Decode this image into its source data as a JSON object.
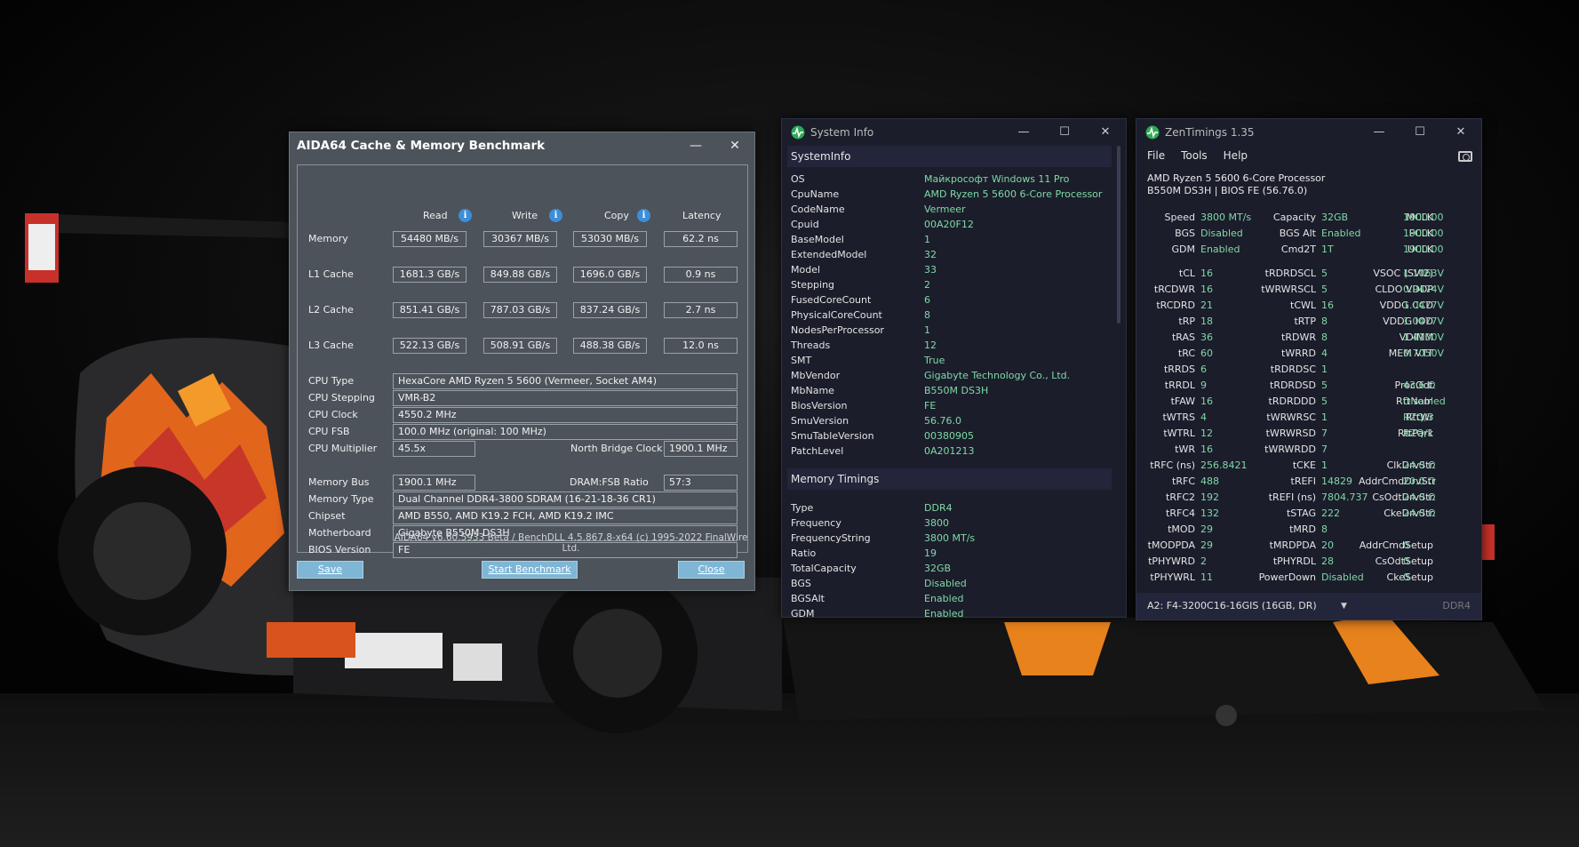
{
  "aida": {
    "title": "AIDA64 Cache & Memory Benchmark",
    "controls": {
      "minimize": "—",
      "close": "✕"
    },
    "columns": [
      "Read",
      "Write",
      "Copy",
      "Latency"
    ],
    "bench": [
      {
        "label": "Memory",
        "read": "54480 MB/s",
        "write": "30367 MB/s",
        "copy": "53030 MB/s",
        "latency": "62.2 ns"
      },
      {
        "label": "L1 Cache",
        "read": "1681.3 GB/s",
        "write": "849.88 GB/s",
        "copy": "1696.0 GB/s",
        "latency": "0.9 ns"
      },
      {
        "label": "L2 Cache",
        "read": "851.41 GB/s",
        "write": "787.03 GB/s",
        "copy": "837.24 GB/s",
        "latency": "2.7 ns"
      },
      {
        "label": "L3 Cache",
        "read": "522.13 GB/s",
        "write": "508.91 GB/s",
        "copy": "488.38 GB/s",
        "latency": "12.0 ns"
      }
    ],
    "cpu_type_label": "CPU Type",
    "cpu_type": "HexaCore AMD Ryzen 5 5600  (Vermeer, Socket AM4)",
    "cpu_stepping_label": "CPU Stepping",
    "cpu_stepping": "VMR-B2",
    "cpu_clock_label": "CPU Clock",
    "cpu_clock": "4550.2 MHz",
    "cpu_fsb_label": "CPU FSB",
    "cpu_fsb": "100.0 MHz  (original: 100 MHz)",
    "cpu_mult_label": "CPU Multiplier",
    "cpu_mult": "45.5x",
    "nb_clock_label": "North Bridge Clock",
    "nb_clock": "1900.1 MHz",
    "mem_bus_label": "Memory Bus",
    "mem_bus": "1900.1 MHz",
    "dram_ratio_label": "DRAM:FSB Ratio",
    "dram_ratio": "57:3",
    "mem_type_label": "Memory Type",
    "mem_type": "Dual Channel DDR4-3800 SDRAM  (16-21-18-36 CR1)",
    "chipset_label": "Chipset",
    "chipset": "AMD B550, AMD K19.2 FCH, AMD K19.2 IMC",
    "mobo_label": "Motherboard",
    "mobo": "Gigabyte B550M DS3H",
    "bios_label": "BIOS Version",
    "bios": "FE",
    "footer": "AIDA64 v6.60.5933 Beta / BenchDLL 4.5.867.8-x64  (c) 1995-2022 FinalWire Ltd.",
    "save": "Save",
    "start": "Start Benchmark",
    "close": "Close"
  },
  "sys": {
    "title": "System Info",
    "controls": {
      "minimize": "—",
      "maximize": "☐",
      "close": "✕"
    },
    "sec1": "SystemInfo",
    "info": [
      {
        "k": "OS",
        "v": "Майкрософт Windows 11 Pro"
      },
      {
        "k": "CpuName",
        "v": "AMD Ryzen 5 5600 6-Core Processor"
      },
      {
        "k": "CodeName",
        "v": "Vermeer"
      },
      {
        "k": "Cpuid",
        "v": "00A20F12"
      },
      {
        "k": "BaseModel",
        "v": "1"
      },
      {
        "k": "ExtendedModel",
        "v": "32"
      },
      {
        "k": "Model",
        "v": "33"
      },
      {
        "k": "Stepping",
        "v": "2"
      },
      {
        "k": "FusedCoreCount",
        "v": "6"
      },
      {
        "k": "PhysicalCoreCount",
        "v": "8"
      },
      {
        "k": "NodesPerProcessor",
        "v": "1"
      },
      {
        "k": "Threads",
        "v": "12"
      },
      {
        "k": "SMT",
        "v": "True"
      },
      {
        "k": "MbVendor",
        "v": "Gigabyte Technology Co., Ltd."
      },
      {
        "k": "MbName",
        "v": "B550M DS3H"
      },
      {
        "k": "BiosVersion",
        "v": "FE"
      },
      {
        "k": "SmuVersion",
        "v": "56.76.0"
      },
      {
        "k": "SmuTableVersion",
        "v": "00380905"
      },
      {
        "k": "PatchLevel",
        "v": "0A201213"
      }
    ],
    "sec2": "Memory Timings",
    "timings": [
      {
        "k": "Type",
        "v": "DDR4"
      },
      {
        "k": "Frequency",
        "v": "3800"
      },
      {
        "k": "FrequencyString",
        "v": "3800 MT/s"
      },
      {
        "k": "Ratio",
        "v": "19"
      },
      {
        "k": "TotalCapacity",
        "v": "32GB"
      },
      {
        "k": "BGS",
        "v": "Disabled"
      },
      {
        "k": "BGSAlt",
        "v": "Enabled"
      },
      {
        "k": "GDM",
        "v": "Enabled"
      }
    ]
  },
  "zen": {
    "title": "ZenTimings 1.35",
    "controls": {
      "minimize": "—",
      "maximize": "☐",
      "close": "✕"
    },
    "menu": [
      "File",
      "Tools",
      "Help"
    ],
    "cpu": "AMD Ryzen 5 5600 6-Core Processor",
    "board": "B550M DS3H | BIOS FE (56.76.0)",
    "top": [
      [
        "Speed",
        "3800 MT/s",
        "Capacity",
        "32GB",
        "MCLK",
        "1900.00"
      ],
      [
        "BGS",
        "Disabled",
        "BGS Alt",
        "Enabled",
        "FCLK",
        "1900.00"
      ],
      [
        "GDM",
        "Enabled",
        "Cmd2T",
        "1T",
        "UCLK",
        "1900.00"
      ]
    ],
    "timings": [
      [
        "tCL",
        "16",
        "tRDRDSCL",
        "5",
        "VSOC (SVI2)",
        "1.1063V"
      ],
      [
        "tRCDWR",
        "16",
        "tWRWRSCL",
        "5",
        "CLDO VDDP",
        "0.9474V"
      ],
      [
        "tRCDRD",
        "21",
        "tCWL",
        "16",
        "VDDG CCD",
        "1.0477V"
      ],
      [
        "tRP",
        "18",
        "tRTP",
        "8",
        "VDDG IOD",
        "1.0477V"
      ],
      [
        "tRAS",
        "36",
        "tRDWR",
        "8",
        "VDIMM",
        "1.4100V"
      ],
      [
        "tRC",
        "60",
        "tWRRD",
        "4",
        "MEM VTT",
        "0.7050V"
      ],
      [
        "tRRDS",
        "6",
        "tRDRDSC",
        "1",
        "",
        ""
      ],
      [
        "tRRDL",
        "9",
        "tRDRDSD",
        "5",
        "ProcOdt",
        "43.6 Ω"
      ],
      [
        "tFAW",
        "16",
        "tRDRDDD",
        "5",
        "RttNom",
        "Disabled"
      ],
      [
        "tWTRS",
        "4",
        "tWRWRSC",
        "1",
        "RttWr",
        "RZQ/3"
      ],
      [
        "tWTRL",
        "12",
        "tWRWRSD",
        "7",
        "RttPark",
        "RZQ/1"
      ],
      [
        "tWR",
        "16",
        "tWRWRDD",
        "7",
        "",
        ""
      ],
      [
        "tRFC (ns)",
        "256.8421",
        "tCKE",
        "1",
        "ClkDrvStr",
        "24.0 Ω"
      ],
      [
        "tRFC",
        "488",
        "tREFI",
        "14829",
        "AddrCmdDrvStr",
        "20.0 Ω"
      ],
      [
        "tRFC2",
        "192",
        "tREFI (ns)",
        "7804.737",
        "CsOdtDrvStr",
        "24.0 Ω"
      ],
      [
        "tRFC4",
        "132",
        "tSTAG",
        "222",
        "CkeDrvStr",
        "24.0 Ω"
      ],
      [
        "tMOD",
        "29",
        "tMRD",
        "8",
        "",
        ""
      ],
      [
        "tMODPDA",
        "29",
        "tMRDPDA",
        "20",
        "AddrCmdSetup",
        "0"
      ],
      [
        "tPHYWRD",
        "2",
        "tPHYRDL",
        "28",
        "CsOdtSetup",
        "0"
      ],
      [
        "tPHYWRL",
        "11",
        "PowerDown",
        "Disabled",
        "CkeSetup",
        "0"
      ]
    ],
    "dimm": "A2: F4-3200C16-16GIS (16GB, DR)",
    "ddr": "DDR4"
  }
}
